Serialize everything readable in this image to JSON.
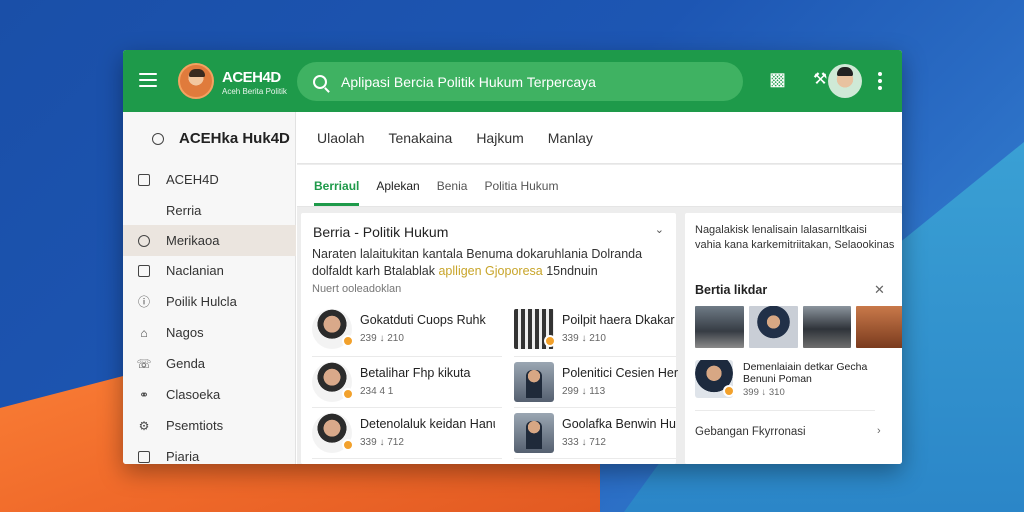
{
  "header": {
    "brand_name": "ACEH4D",
    "brand_tagline": "Aceh Berita Politik",
    "search_placeholder": "Aplipasi Bercia Politik Hukum Terpercaya"
  },
  "sidebar": {
    "title": "ACEHka Huk4D",
    "items": [
      {
        "label": "ACEH4D"
      },
      {
        "label": "Rerria"
      },
      {
        "label": "Merikaoa"
      },
      {
        "label": "Naclanian"
      },
      {
        "label": "Poilik Hulcla"
      },
      {
        "label": "Nagos"
      },
      {
        "label": "Genda"
      },
      {
        "label": "Clasoeka"
      },
      {
        "label": "Psemtiots"
      },
      {
        "label": "Piaria"
      }
    ]
  },
  "tabs_primary": [
    "Ulaolah",
    "Tenakaina",
    "Hajkum",
    "Manlay"
  ],
  "tabs_secondary": [
    "Berriaul",
    "Aplekan",
    "Benia",
    "Politia Hukum"
  ],
  "card_main": {
    "title": "Berria - Politik Hukum",
    "desc_line1": "Naraten lalaitukitan kantala Benuma dokaruhlania Dolranda",
    "desc_line2_a": "dolfaldt karh Btalablak",
    "desc_line2_b": "aplligen Gjoporesa",
    "desc_line2_c": "15ndnuin",
    "meta": "Nuert ooleadoklan",
    "stories": [
      {
        "title": "Gokatduti Cuops Ruhk",
        "meta": "239 ↓ 210"
      },
      {
        "title": "Poilpit haera Dkakar",
        "meta": "339 ↓ 210"
      },
      {
        "title": "Betalihar Fhp kikuta",
        "meta": "234 4 1"
      },
      {
        "title": "Polenitici Cesien Her",
        "meta": "299 ↓ 113"
      },
      {
        "title": "Detenolaluk keidan Hanum",
        "meta": "339 ↓ 712"
      },
      {
        "title": "Goolafka Benwin Hu",
        "meta": "333 ↓ 712"
      }
    ]
  },
  "card_side": {
    "desc_line1": "Nagalakisk lenalisain lalasarnltkaisi",
    "desc_line2": "vahia kana karkemitriitakan, Selaookinas",
    "heading": "Bertia likdar",
    "story_title": "Demenlaiain detkar Gecha Benuni Poman",
    "story_meta": "399 ↓ 310",
    "footer": "Gebangan Fkyrronasi"
  },
  "colors": {
    "primary": "#1e9a4a",
    "highlight": "#c8a52a",
    "badge": "#f2a12c"
  }
}
